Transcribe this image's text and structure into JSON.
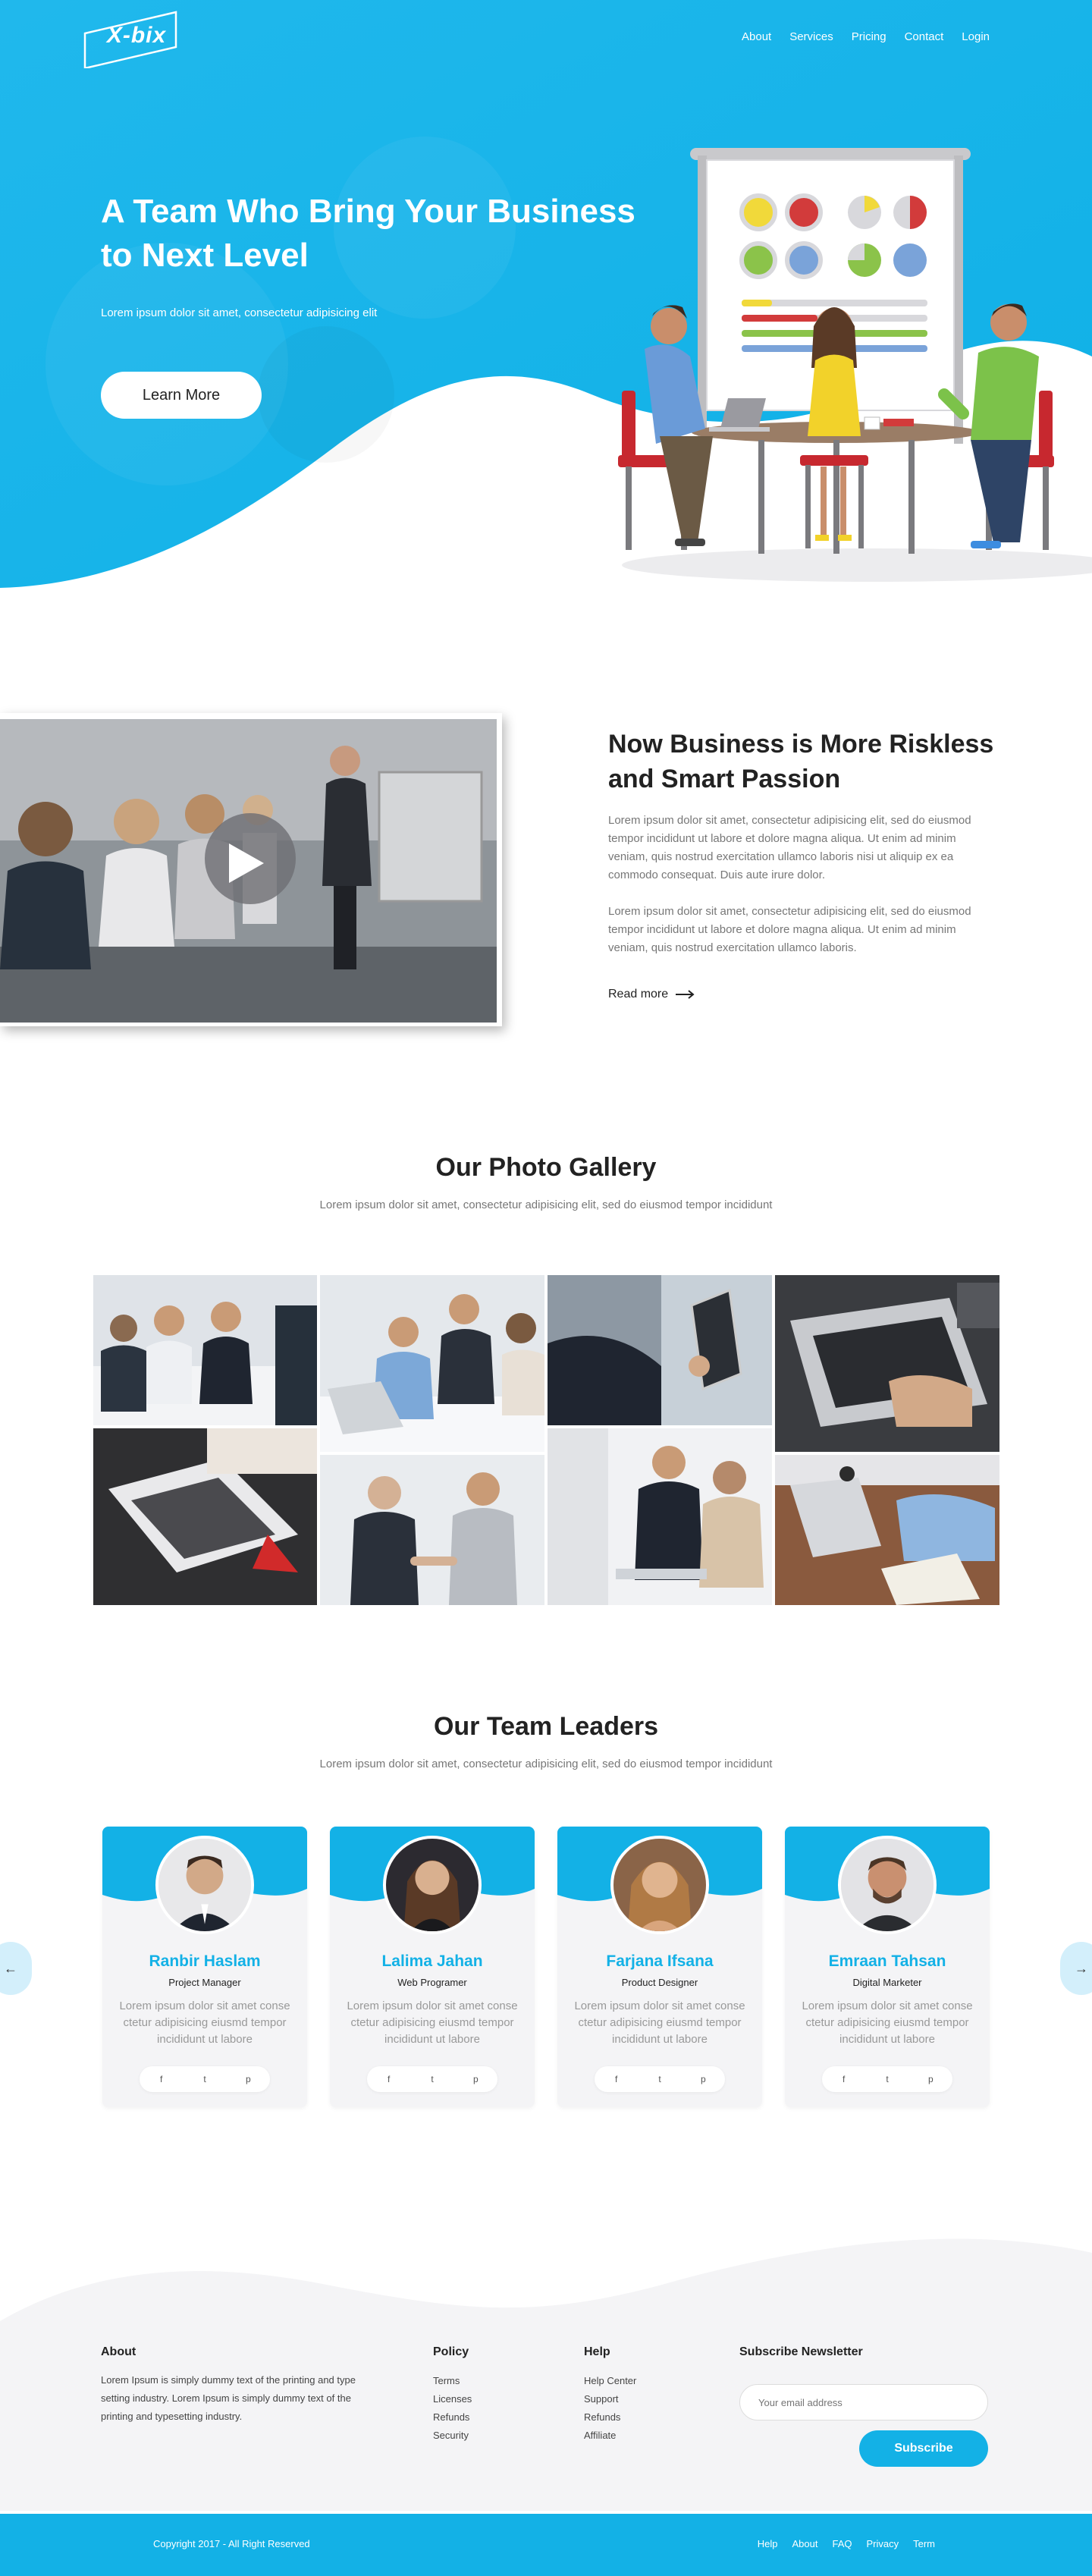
{
  "brand": {
    "logo_text": "X-bix"
  },
  "nav": {
    "items": [
      "About",
      "Services",
      "Pricing",
      "Contact",
      "Login"
    ]
  },
  "hero": {
    "title_line1": "A Team Who Bring Your Business",
    "title_line2": "to Next Level",
    "subtitle": "Lorem ipsum dolor sit amet, consectetur adipisicing elit",
    "cta": "Learn More"
  },
  "about": {
    "title_line1": "Now Business is More Riskless",
    "title_line2": "and Smart Passion",
    "paragraph1": "Lorem ipsum dolor sit amet, consectetur adipisicing elit, sed do eiusmod tempor incididunt ut labore et dolore magna aliqua. Ut enim ad minim veniam, quis nostrud exercitation ullamco laboris nisi ut aliquip ex ea commodo consequat. Duis aute irure dolor.",
    "paragraph2": "Lorem ipsum dolor sit amet, consectetur adipisicing elit, sed do eiusmod tempor incididunt ut labore et dolore magna aliqua. Ut enim ad minim veniam, quis nostrud exercitation ullamco laboris.",
    "read_more": "Read more"
  },
  "gallery": {
    "title": "Our Photo Gallery",
    "subtitle": "Lorem ipsum dolor sit amet, consectetur adipisicing elit, sed do eiusmod tempor incididunt"
  },
  "team": {
    "title": "Our Team Leaders",
    "subtitle": "Lorem ipsum dolor sit amet, consectetur adipisicing elit, sed do eiusmod tempor incididunt",
    "members": [
      {
        "name": "Ranbir Haslam",
        "role": "Project Manager",
        "desc": "Lorem ipsum dolor sit amet conse ctetur adipisicing eiusmd tempor incididunt ut labore"
      },
      {
        "name": "Lalima Jahan",
        "role": "Web Programer",
        "desc": "Lorem ipsum dolor sit amet conse ctetur adipisicing eiusmd tempor incididunt ut labore"
      },
      {
        "name": "Farjana Ifsana",
        "role": "Product Designer",
        "desc": "Lorem ipsum dolor sit amet conse ctetur adipisicing eiusmd tempor incididunt ut labore"
      },
      {
        "name": "Emraan Tahsan",
        "role": "Digital Marketer",
        "desc": "Lorem ipsum dolor sit amet conse ctetur adipisicing eiusmd tempor incididunt ut labore"
      }
    ],
    "social": [
      "f",
      "t",
      "p"
    ],
    "prev_arrow": "←",
    "next_arrow": "→"
  },
  "footer": {
    "about_head": "About",
    "about_text": "Lorem Ipsum is simply dummy text of the printing and type setting industry. Lorem Ipsum is simply dummy text of the printing and typesetting industry.",
    "policy_head": "Policy",
    "policy_items": [
      "Terms",
      "Licenses",
      "Refunds",
      "Security"
    ],
    "help_head": "Help",
    "help_items": [
      "Help Center",
      "Support",
      "Refunds",
      "Affiliate"
    ],
    "newsletter_head": "Subscribe Newsletter",
    "email_placeholder": "Your email address",
    "subscribe": "Subscribe",
    "copyright": "Copyright 2017 - All Right Reserved",
    "bottom_links": [
      "Help",
      "About",
      "FAQ",
      "Privacy",
      "Term"
    ]
  },
  "colors": {
    "primary": "#13b1e6",
    "dark": "#222222",
    "muted": "#777777"
  }
}
